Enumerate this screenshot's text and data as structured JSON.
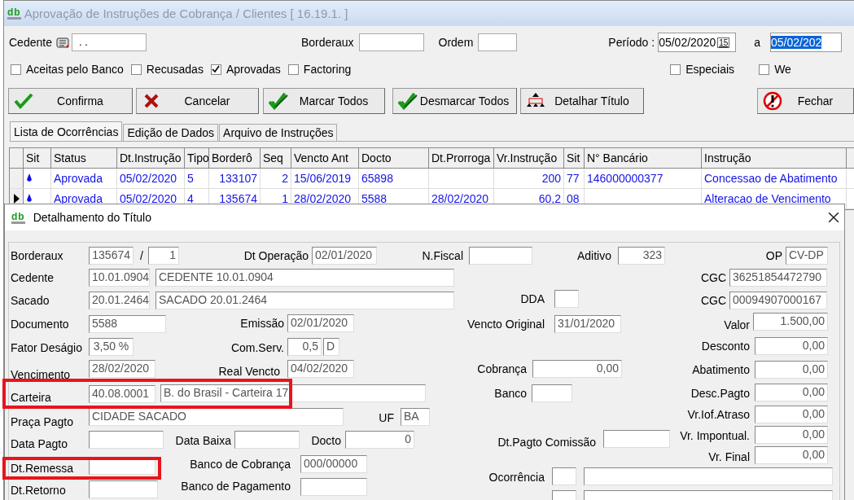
{
  "window": {
    "logo": "db",
    "title": "Aprovação de Instruções de Cobrança / Clientes [ 16.19.1. ]"
  },
  "filters": {
    "cedente_label": "Cedente",
    "cedente_value": ". .",
    "borderaux_label": "Borderaux",
    "ordem_label": "Ordem",
    "periodo_label": "Período :",
    "calendar_label": "15",
    "separator": "a",
    "period": [
      {
        "value": "05/02/2020",
        "highlighted": false
      },
      {
        "value": "05/02/202",
        "highlighted": true
      }
    ]
  },
  "checkboxes": [
    {
      "label": "Aceitas pelo Banco",
      "checked": false
    },
    {
      "label": "Recusadas",
      "checked": false
    },
    {
      "label": "Aprovadas",
      "checked": true
    },
    {
      "label": "Factoring",
      "checked": false
    },
    {
      "label": "Especiais",
      "checked": false
    },
    {
      "label": "We",
      "checked": false
    }
  ],
  "buttons": [
    {
      "label": "Confirma",
      "kind": "check"
    },
    {
      "label": "Cancelar",
      "kind": "cross"
    },
    {
      "label": "Marcar Todos",
      "kind": "double-check"
    },
    {
      "label": "Desmarcar Todos",
      "kind": "double-check"
    },
    {
      "label": "Detalhar Título",
      "kind": "tree"
    },
    {
      "label": "Fechar",
      "kind": "stop"
    }
  ],
  "tabs": [
    {
      "label": "Lista de Ocorrências",
      "selected": true
    },
    {
      "label": "Edição de Dados",
      "selected": false
    },
    {
      "label": "Arquivo de Instruções",
      "selected": false
    }
  ],
  "table": {
    "columns": [
      "Sit",
      "Status",
      "Dt.Instrução",
      "Tipo",
      "Borderô",
      "Seq",
      "Vencto Ant",
      "Docto",
      "Dt.Prorroga",
      "Vr.Instrução",
      "Sit",
      "N° Bancário",
      "Instrução"
    ],
    "rows": [
      {
        "selected": false,
        "cells": [
          "",
          "Aprovada",
          "05/02/2020",
          "5",
          "133107",
          "2",
          "15/06/2019",
          "65898",
          "",
          "200",
          "77",
          "146000000377",
          "Concessao de Abatimento"
        ]
      },
      {
        "selected": true,
        "cells": [
          "",
          "Aprovada",
          "05/02/2020",
          "4",
          "135674",
          "1",
          "28/02/2020",
          "5588",
          "28/02/2020",
          "60,2",
          "08",
          "",
          "Alteracao de Vencimento"
        ]
      }
    ]
  },
  "dialog": {
    "logo": "db",
    "title": "Detalhamento do Título",
    "items": [
      {
        "kind": "label",
        "text": "Borderaux"
      },
      {
        "kind": "field",
        "value": "135674"
      },
      {
        "kind": "text",
        "text": "/"
      },
      {
        "kind": "field",
        "value": "1"
      },
      {
        "kind": "label",
        "text": "Dt Operação"
      },
      {
        "kind": "field",
        "value": "02/01/2020"
      },
      {
        "kind": "label",
        "text": "N.Fiscal"
      },
      {
        "kind": "field"
      },
      {
        "kind": "label",
        "text": "Aditivo"
      },
      {
        "kind": "field",
        "value": "323"
      },
      {
        "kind": "label",
        "text": "OP"
      },
      {
        "kind": "field",
        "value": "CV-DP"
      },
      {
        "kind": "label",
        "text": "Cedente"
      },
      {
        "kind": "field",
        "value": "10.01.0904"
      },
      {
        "kind": "field",
        "value": "CEDENTE 10.01.0904"
      },
      {
        "kind": "label",
        "text": "CGC"
      },
      {
        "kind": "field",
        "value": "36251854472790"
      },
      {
        "kind": "label",
        "text": "Sacado"
      },
      {
        "kind": "field",
        "value": "20.01.2464"
      },
      {
        "kind": "field",
        "value": "SACADO 20.01.2464"
      },
      {
        "kind": "label",
        "text": "DDA"
      },
      {
        "kind": "field"
      },
      {
        "kind": "label",
        "text": "CGC"
      },
      {
        "kind": "field",
        "value": "00094907000167"
      },
      {
        "kind": "label",
        "text": "Documento"
      },
      {
        "kind": "field",
        "value": "5588"
      },
      {
        "kind": "label",
        "text": "Emissão"
      },
      {
        "kind": "field",
        "value": "02/01/2020"
      },
      {
        "kind": "label",
        "text": "Vencto Original"
      },
      {
        "kind": "field",
        "value": "31/01/2020"
      },
      {
        "kind": "label",
        "text": "Valor"
      },
      {
        "kind": "field",
        "value": "1.500,00"
      },
      {
        "kind": "label",
        "text": "Fator Deságio"
      },
      {
        "kind": "field",
        "value": "3,50 %"
      },
      {
        "kind": "label",
        "text": "Com.Serv."
      },
      {
        "kind": "field",
        "value": "0,5"
      },
      {
        "kind": "field",
        "value": "D"
      },
      {
        "kind": "label",
        "text": "Desconto"
      },
      {
        "kind": "field",
        "value": "0,00"
      },
      {
        "kind": "label",
        "text": "Vencimento"
      },
      {
        "kind": "field",
        "value": "28/02/2020"
      },
      {
        "kind": "label",
        "text": "Real Vencto"
      },
      {
        "kind": "field",
        "value": "04/02/2020"
      },
      {
        "kind": "label",
        "text": "Cobrança"
      },
      {
        "kind": "field",
        "value": "0,00"
      },
      {
        "kind": "label",
        "text": "Abatimento"
      },
      {
        "kind": "field",
        "value": "0,00"
      },
      {
        "kind": "label",
        "text": "Carteira"
      },
      {
        "kind": "field",
        "value": "40.08.0001"
      },
      {
        "kind": "field",
        "value": "B. do Brasil - Carteira 17"
      },
      {
        "kind": "label",
        "text": "Banco"
      },
      {
        "kind": "field"
      },
      {
        "kind": "label",
        "text": "Desc.Pagto"
      },
      {
        "kind": "field",
        "value": "0,00"
      },
      {
        "kind": "label",
        "text": "Praça Pagto"
      },
      {
        "kind": "field",
        "value": "CIDADE SACADO"
      },
      {
        "kind": "label",
        "text": "UF"
      },
      {
        "kind": "field",
        "value": "BA"
      },
      {
        "kind": "label",
        "text": "Vr.Iof.Atraso"
      },
      {
        "kind": "field",
        "value": "0,00"
      },
      {
        "kind": "label",
        "text": "Data Pagto"
      },
      {
        "kind": "field"
      },
      {
        "kind": "label",
        "text": "Data Baixa"
      },
      {
        "kind": "field"
      },
      {
        "kind": "label",
        "text": "Docto"
      },
      {
        "kind": "field",
        "value": "0"
      },
      {
        "kind": "label",
        "text": "Dt.Pagto Comissão"
      },
      {
        "kind": "field"
      },
      {
        "kind": "label",
        "text": "Vr. Impontual."
      },
      {
        "kind": "field",
        "value": "0,00"
      },
      {
        "kind": "label",
        "text": "Dt.Remessa"
      },
      {
        "kind": "field"
      },
      {
        "kind": "label",
        "text": "Banco de Cobrança"
      },
      {
        "kind": "field",
        "value": "000/00000"
      },
      {
        "kind": "label",
        "text": "Vr. Final"
      },
      {
        "kind": "field",
        "value": "0,00"
      },
      {
        "kind": "label",
        "text": "Dt.Retorno"
      },
      {
        "kind": "field"
      },
      {
        "kind": "label",
        "text": "Banco de Pagamento"
      },
      {
        "kind": "field"
      },
      {
        "kind": "label",
        "text": "Ocorrência"
      },
      {
        "kind": "field"
      },
      {
        "kind": "field"
      },
      {
        "kind": "field"
      },
      {
        "kind": "field"
      }
    ]
  }
}
